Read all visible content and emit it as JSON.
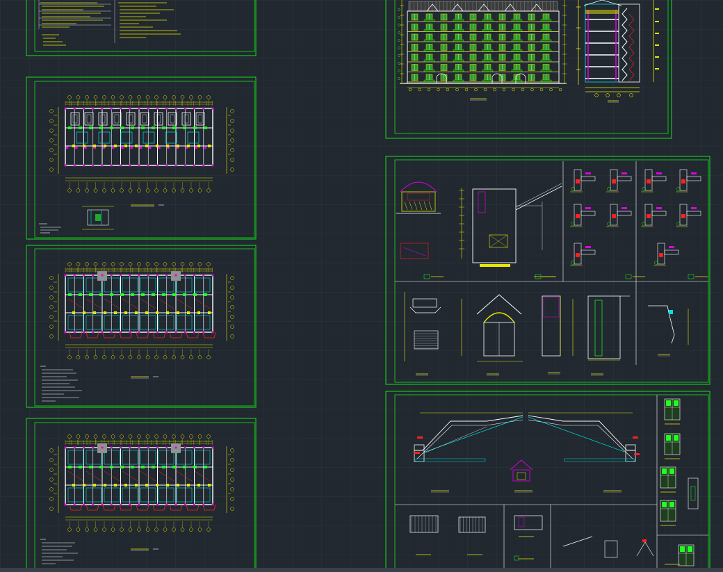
{
  "window": {
    "title": ""
  },
  "colors": {
    "background": "#212830",
    "grid": "#2b333c",
    "frame": "#17e017",
    "wall": "#ffffff",
    "dimension": "#e8e800",
    "cyan": "#00e0e0",
    "magenta": "#e000e0",
    "red": "#ff2020",
    "green": "#20ff20"
  },
  "sheets": [
    {
      "id": "notes-sheet",
      "type": "notes"
    },
    {
      "id": "plan-1",
      "type": "floor-plan"
    },
    {
      "id": "plan-2",
      "type": "floor-plan"
    },
    {
      "id": "plan-3",
      "type": "floor-plan"
    },
    {
      "id": "elevation-section",
      "type": "elevation"
    },
    {
      "id": "details-1",
      "type": "details"
    },
    {
      "id": "roof-details",
      "type": "roof"
    }
  ]
}
